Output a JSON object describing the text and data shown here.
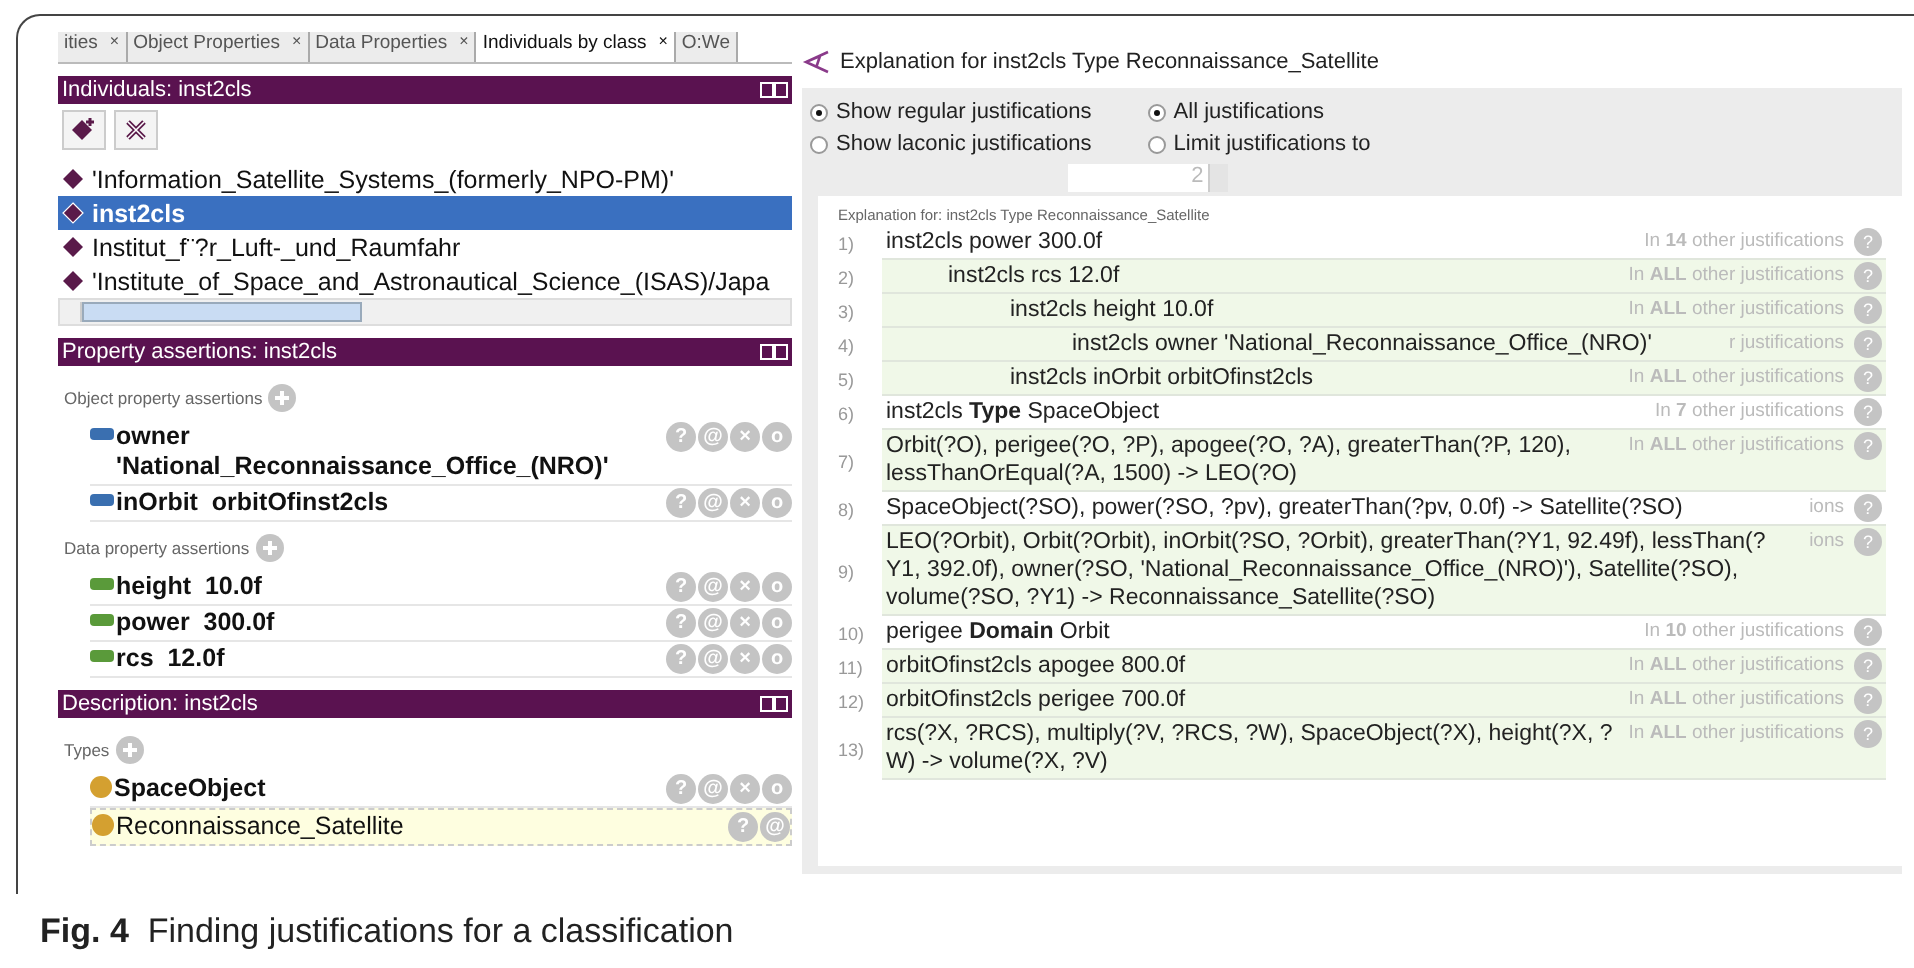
{
  "tabs": [
    {
      "label": "ities",
      "close_mark": "×",
      "selected": false
    },
    {
      "label": "Object Properties",
      "close_mark": "×",
      "selected": false
    },
    {
      "label": "Data Properties",
      "close_mark": "×",
      "selected": false
    },
    {
      "label": "Individuals by class",
      "close_mark": "×",
      "selected": true
    },
    {
      "label": "O:We",
      "selected": false
    }
  ],
  "individuals_panel": {
    "title": "Individuals: inst2cls",
    "items": [
      {
        "label": "'Information_Satellite_Systems_(formerly_NPO-PM)'",
        "selected": false
      },
      {
        "label": "inst2cls",
        "selected": true
      },
      {
        "label": "Institut_f¨?r_Luft-_und_Raumfahr",
        "selected": false
      },
      {
        "label": "'Institute_of_Space_and_Astronautical_Science_(ISAS)/Japa",
        "selected": false
      }
    ]
  },
  "property_panel": {
    "title": "Property assertions: inst2cls",
    "sections": [
      {
        "heading": "Object property assertions",
        "kind": "object",
        "rows": [
          {
            "label": "owner",
            "value": "'National_Reconnaissance_Office_(NRO)'",
            "wrap": true,
            "selected": false,
            "actions": [
              "?",
              "@",
              "×",
              "o"
            ]
          },
          {
            "label": "inOrbit",
            "value": "orbitOfinst2cls",
            "wrap": false,
            "selected": false,
            "actions": [
              "?",
              "@",
              "×",
              "o"
            ]
          }
        ]
      },
      {
        "heading": "Data property assertions",
        "kind": "data",
        "rows": [
          {
            "label": "height",
            "value": "10.0f",
            "wrap": false,
            "selected": false,
            "actions": [
              "?",
              "@",
              "×",
              "o"
            ]
          },
          {
            "label": "power",
            "value": "300.0f",
            "wrap": false,
            "selected": false,
            "actions": [
              "?",
              "@",
              "×",
              "o"
            ]
          },
          {
            "label": "rcs",
            "value": "12.0f",
            "wrap": false,
            "selected": false,
            "actions": [
              "?",
              "@",
              "×",
              "o"
            ]
          }
        ]
      }
    ]
  },
  "description_panel": {
    "title": "Description: inst2cls",
    "sections": [
      {
        "heading": "Types",
        "kind": "class",
        "rows": [
          {
            "label": "SpaceObject",
            "selected": false,
            "actions": [
              "?",
              "@",
              "×",
              "o"
            ]
          },
          {
            "label": "Reconnaissance_Satellite",
            "selected": true,
            "actions": [
              "?",
              "@"
            ]
          }
        ]
      }
    ]
  },
  "explanation_window": {
    "title": "Explanation for inst2cls Type Reconnaissance_Satellite",
    "mode_options": [
      {
        "label": "Show regular justifications",
        "selected": true
      },
      {
        "label": "Show laconic justifications",
        "selected": false
      }
    ],
    "limit_options": [
      {
        "label": "All justifications",
        "selected": true
      },
      {
        "label": "Limit justifications to",
        "selected": false
      }
    ],
    "limit_value": "2",
    "heading": "Explanation for: inst2cls Type Reconnaissance_Satellite",
    "help_mark": "?",
    "rows": [
      {
        "number": "1)",
        "text": "inst2cls power 300.0f",
        "usage": "In **14** other justifications",
        "in_all": false,
        "children": [
          {
            "number": "2)",
            "text": "inst2cls rcs 12.0f",
            "usage": "In **ALL** other justifications",
            "in_all": true,
            "children": [
              {
                "number": "3)",
                "text": "inst2cls height 10.0f",
                "usage": "In **ALL** other justifications",
                "in_all": true,
                "children": [
                  {
                    "number": "4)",
                    "text": "inst2cls owner 'National_Reconnaissance_Office_(NRO)'",
                    "usage": "r justifications",
                    "in_all": true
                  }
                ]
              },
              {
                "number": "5)",
                "text": "inst2cls inOrbit orbitOfinst2cls",
                "usage": "In **ALL** other justifications",
                "in_all": true
              }
            ]
          }
        ]
      },
      {
        "number": "6)",
        "text": "inst2cls **Type** SpaceObject",
        "usage": "In **7** other justifications",
        "in_all": false
      },
      {
        "number": "7)",
        "text": "Orbit(?O), perigee(?O, ?P), apogee(?O, ?A), greaterThan(?P, 120), lessThanOrEqual(?A, 1500) -> LEO(?O)",
        "usage": "In **ALL** other justifications",
        "in_all": true
      },
      {
        "number": "8)",
        "text": "SpaceObject(?SO), power(?SO, ?pv), greaterThan(?pv, 0.0f) -> Satellite(?SO)",
        "usage": "ions",
        "in_all": false
      },
      {
        "number": "9)",
        "text": "LEO(?Orbit), Orbit(?Orbit), inOrbit(?SO, ?Orbit), greaterThan(?Y1, 92.49f), lessThan(?Y1, 392.0f), owner(?SO, 'National_Reconnaissance_Office_(NRO)'), Satellite(?SO), volume(?SO, ?Y1) -> Reconnaissance_Satellite(?SO)",
        "usage": "ions",
        "in_all": true
      },
      {
        "number": "10)",
        "text": "perigee **Domain** Orbit",
        "usage": "In **10** other justifications",
        "in_all": false
      },
      {
        "number": "11)",
        "text": "orbitOfinst2cls apogee 800.0f",
        "usage": "In **ALL** other justifications",
        "in_all": true
      },
      {
        "number": "12)",
        "text": "orbitOfinst2cls perigee 700.0f",
        "usage": "In **ALL** other justifications",
        "in_all": true
      },
      {
        "number": "13)",
        "text": "rcs(?X, ?RCS), multiply(?V, ?RCS, ?W), SpaceObject(?X), height(?X, ?W) -> volume(?X, ?V)",
        "usage": "In **ALL** other justifications",
        "in_all": true
      }
    ]
  },
  "caption": "**Fig. 4**  Finding justifications for a classification"
}
